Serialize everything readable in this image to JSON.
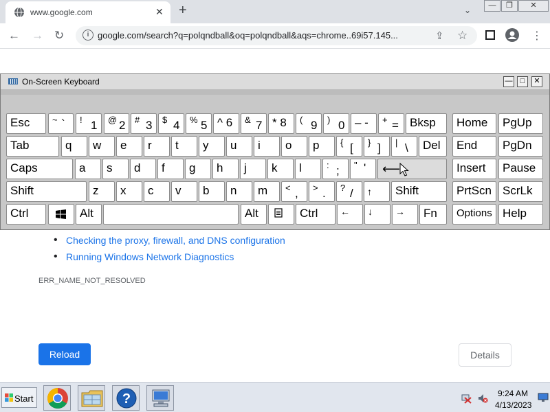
{
  "browser": {
    "tab_title": "www.google.com",
    "tab_close": "✕",
    "new_tab": "+",
    "tab_search": "⌄",
    "url": "google.com/search?q=polqndball&oq=polqndball&aqs=chrome..69i57.145...",
    "nav_icons": [
      "back-icon",
      "forward-icon",
      "reload-icon"
    ],
    "toolbar_icons": [
      "share-icon",
      "star-icon",
      "sidepanel-icon",
      "profile-icon",
      "menu-icon"
    ]
  },
  "osk": {
    "title": "On-Screen Keyboard",
    "minimize": "—",
    "maximize": "□",
    "close": "✕",
    "keys": {
      "esc": "Esc",
      "tilde": "~",
      "backtick": "`",
      "n1s": "!",
      "n1": "1",
      "n2s": "@",
      "n2": "2",
      "n3s": "#",
      "n3": "3",
      "n4s": "$",
      "n4": "4",
      "n5s": "%",
      "n5": "5",
      "n6": "^ 6",
      "n7s": "&",
      "n7": "7",
      "n8": "* 8",
      "n9s": "(",
      "n9": "9",
      "n0s": ")",
      "n0": "0",
      "minus": "– -",
      "pluss": "+",
      "plus": "=",
      "bksp": "Bksp",
      "home": "Home",
      "pgup": "PgUp",
      "tab": "Tab",
      "q": "q",
      "w": "w",
      "e": "e",
      "r": "r",
      "t": "t",
      "y": "y",
      "u": "u",
      "i": "i",
      "o": "o",
      "p": "p",
      "lbrs": "{",
      "lbr": "[",
      "rbrs": "}",
      "rbr": "]",
      "pipes": "|",
      "pipe": "\\",
      "del": "Del",
      "end": "End",
      "pgdn": "PgDn",
      "caps": "Caps",
      "a": "a",
      "s": "s",
      "d": "d",
      "f": "f",
      "g": "g",
      "h": "h",
      "j": "j",
      "k": "k",
      "l": "l",
      "semis": ":",
      "semi": ";",
      "quotes": "\"",
      "quote": "'",
      "insert": "Insert",
      "pause": "Pause",
      "shift": "Shift",
      "z": "z",
      "x": "x",
      "c": "c",
      "v": "v",
      "b": "b",
      "n": "n",
      "m": "m",
      "commas": "<",
      "comma": ",",
      "dots": ">",
      "dot": ".",
      "slashs": "?",
      "slash": "/",
      "up": "↑",
      "shift2": "Shift",
      "prtscn": "PrtScn",
      "scrlk": "ScrLk",
      "ctrl": "Ctrl",
      "alt": "Alt",
      "alt2": "Alt",
      "ctrl2": "Ctrl",
      "left": "←",
      "down": "↓",
      "right": "→",
      "fn": "Fn",
      "options": "Options",
      "help": "Help"
    }
  },
  "error_page": {
    "suggestions": [
      "Checking the proxy, firewall, and DNS configuration",
      "Running Windows Network Diagnostics"
    ],
    "error_code": "ERR_NAME_NOT_RESOLVED",
    "reload_label": "Reload",
    "details_label": "Details"
  },
  "taskbar": {
    "start_label": "Start",
    "apps": [
      "chrome-icon",
      "explorer-icon",
      "help-icon",
      "network-computer-icon"
    ],
    "time": "9:24 AM",
    "date": "4/13/2023"
  }
}
